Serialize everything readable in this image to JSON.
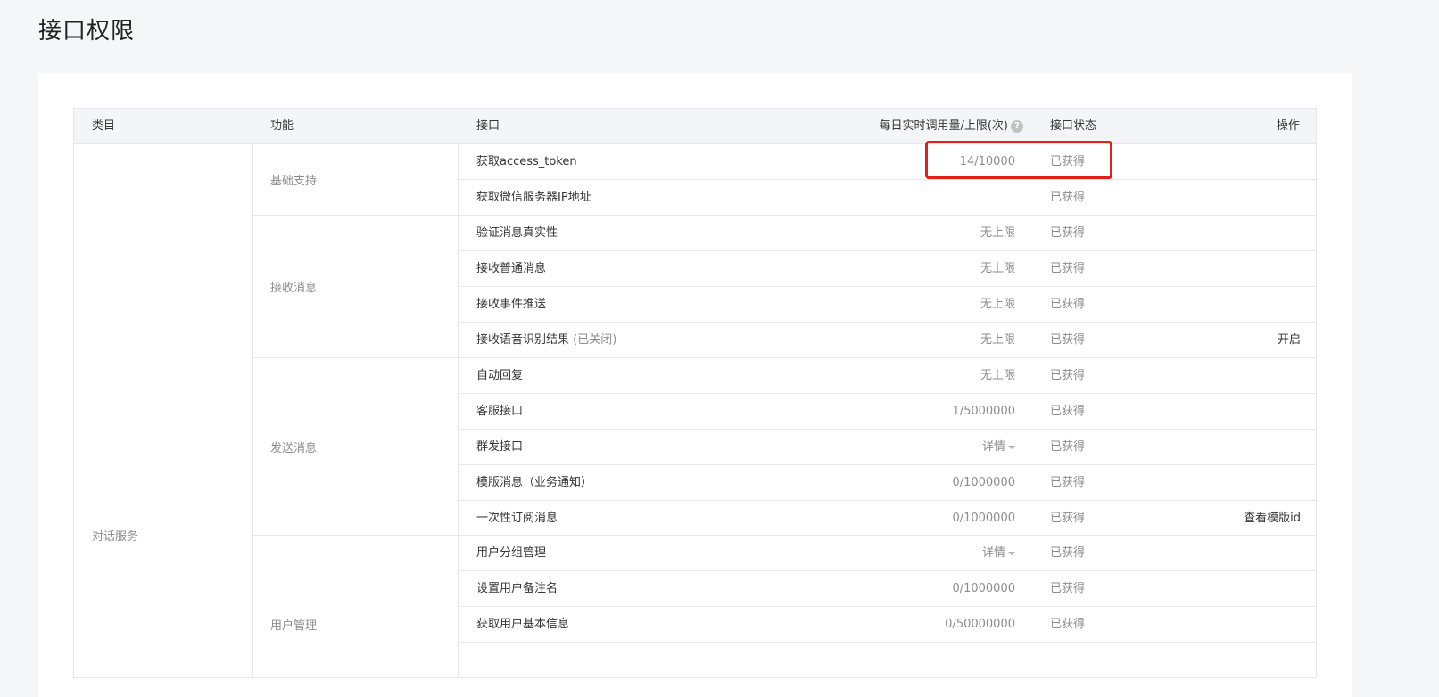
{
  "page": {
    "title": "接口权限"
  },
  "table": {
    "headers": {
      "category": "类目",
      "function": "功能",
      "api": "接口",
      "usage": "每日实时调用量/上限(次)",
      "status": "接口状态",
      "op": "操作"
    },
    "help_icon": "question-icon",
    "category": "对话服务",
    "groups": [
      {
        "name": "基础支持"
      },
      {
        "name": "接收消息"
      },
      {
        "name": "发送消息"
      },
      {
        "name": "用户管理"
      }
    ],
    "rows": [
      {
        "name": "获取access_token",
        "sub": "",
        "usage": "14/10000",
        "status": "已获得",
        "op": ""
      },
      {
        "name": "获取微信服务器IP地址",
        "sub": "",
        "usage": "",
        "status": "已获得",
        "op": ""
      },
      {
        "name": "验证消息真实性",
        "sub": "",
        "usage": "无上限",
        "status": "已获得",
        "op": ""
      },
      {
        "name": "接收普通消息",
        "sub": "",
        "usage": "无上限",
        "status": "已获得",
        "op": ""
      },
      {
        "name": "接收事件推送",
        "sub": "",
        "usage": "无上限",
        "status": "已获得",
        "op": ""
      },
      {
        "name": "接收语音识别结果",
        "sub": "(已关闭)",
        "usage": "无上限",
        "status": "已获得",
        "op": "开启"
      },
      {
        "name": "自动回复",
        "sub": "",
        "usage": "无上限",
        "status": "已获得",
        "op": ""
      },
      {
        "name": "客服接口",
        "sub": "",
        "usage": "1/5000000",
        "status": "已获得",
        "op": ""
      },
      {
        "name": "群发接口",
        "sub": "",
        "usage": "详情",
        "status": "已获得",
        "op": ""
      },
      {
        "name": "模版消息（业务通知）",
        "sub": "",
        "usage": "0/1000000",
        "status": "已获得",
        "op": ""
      },
      {
        "name": "一次性订阅消息",
        "sub": "",
        "usage": "0/1000000",
        "status": "已获得",
        "op": "查看模版id"
      },
      {
        "name": "用户分组管理",
        "sub": "",
        "usage": "详情",
        "status": "已获得",
        "op": ""
      },
      {
        "name": "设置用户备注名",
        "sub": "",
        "usage": "0/1000000",
        "status": "已获得",
        "op": ""
      },
      {
        "name": "获取用户基本信息",
        "sub": "",
        "usage": "0/50000000",
        "status": "已获得",
        "op": ""
      }
    ]
  },
  "colors": {
    "highlight": "#e0201b",
    "header_bg": "#f4f5f9",
    "border": "#e7e7eb"
  }
}
